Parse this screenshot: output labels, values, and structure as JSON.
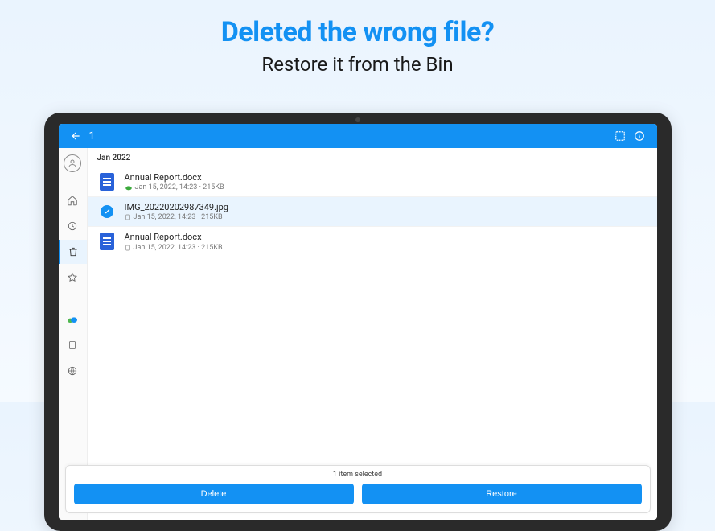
{
  "hero": {
    "title": "Deleted the wrong file?",
    "subtitle": "Restore it from the Bin"
  },
  "topbar": {
    "count": "1"
  },
  "section_header": "Jan 2022",
  "files": [
    {
      "name": "Annual Report.docx",
      "meta": "Jan 15, 2022, 14:23 · 215KB",
      "selected": false,
      "kind": "doc",
      "sync": "cloud-green"
    },
    {
      "name": "IMG_20220202987349.jpg",
      "meta": "Jan 15, 2022, 14:23 · 215KB",
      "selected": true,
      "kind": "image",
      "sync": "device"
    },
    {
      "name": "Annual Report.docx",
      "meta": "Jan 15, 2022, 14:23 · 215KB",
      "selected": false,
      "kind": "doc",
      "sync": "device"
    }
  ],
  "action_bar": {
    "status": "1 item selected",
    "delete": "Delete",
    "restore": "Restore"
  }
}
